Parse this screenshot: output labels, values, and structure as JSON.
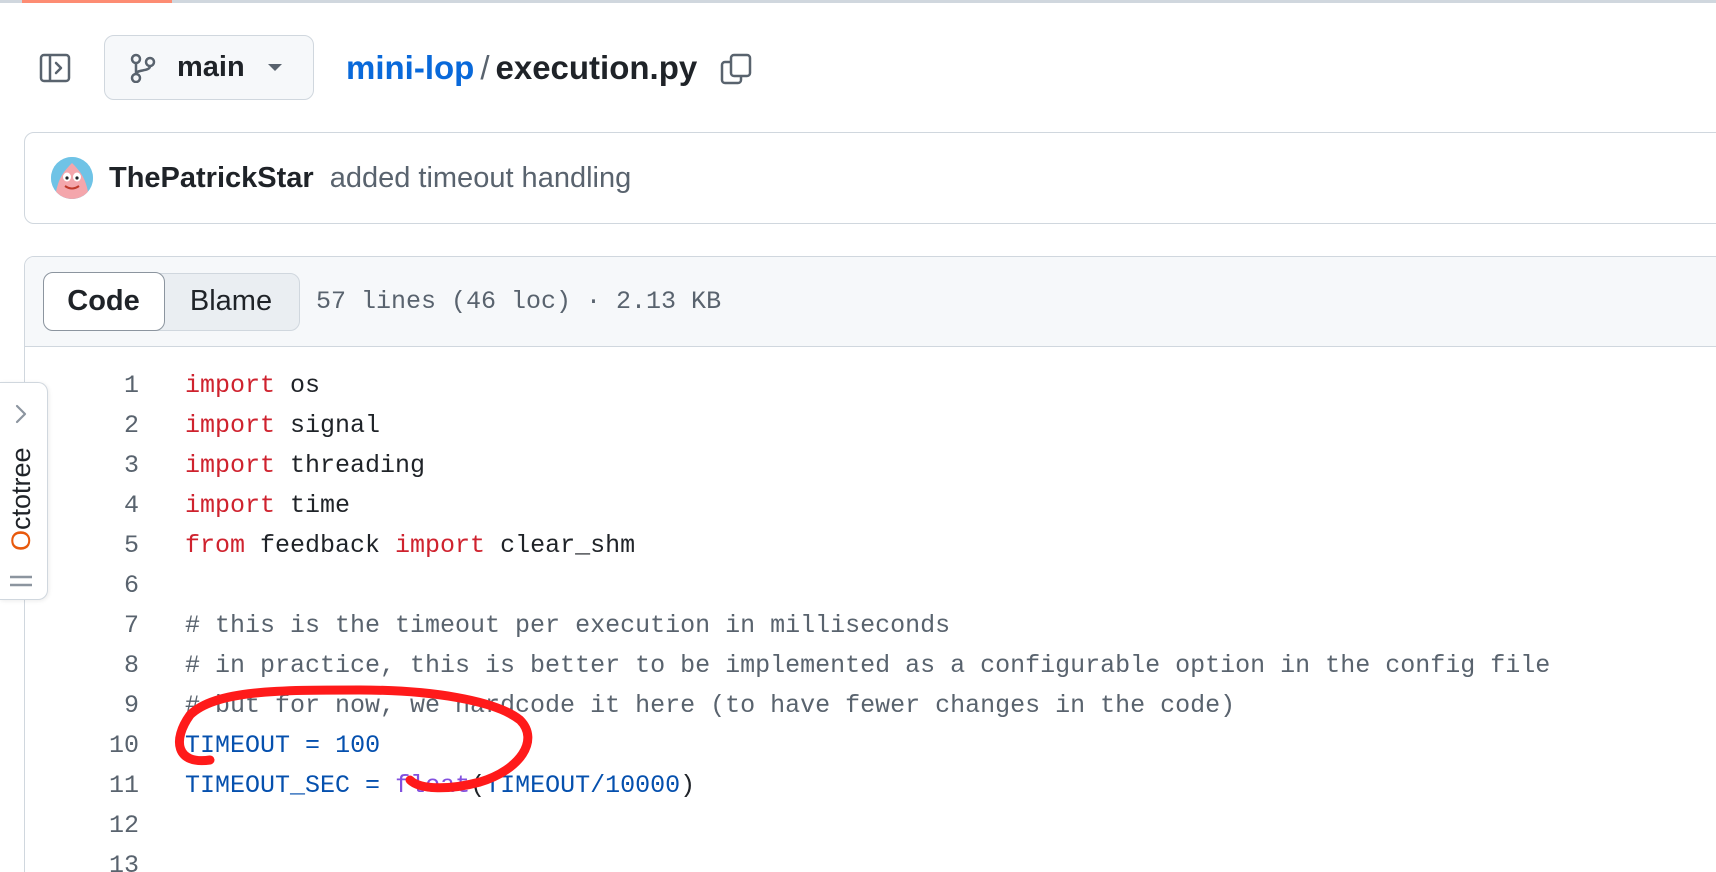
{
  "header": {
    "branch": "main",
    "repo": "mini-lop",
    "separator": "/",
    "file": "execution.py"
  },
  "commit": {
    "author": "ThePatrickStar",
    "message": "added timeout handling"
  },
  "file_header": {
    "code_tab": "Code",
    "blame_tab": "Blame",
    "meta": "57 lines (46 loc) · 2.13 KB"
  },
  "code_lines": [
    {
      "n": "1",
      "tokens": [
        [
          "kw",
          "import"
        ],
        [
          "",
          " os"
        ]
      ]
    },
    {
      "n": "2",
      "tokens": [
        [
          "kw",
          "import"
        ],
        [
          "",
          " signal"
        ]
      ]
    },
    {
      "n": "3",
      "tokens": [
        [
          "kw",
          "import"
        ],
        [
          "",
          " threading"
        ]
      ]
    },
    {
      "n": "4",
      "tokens": [
        [
          "kw",
          "import"
        ],
        [
          "",
          " time"
        ]
      ]
    },
    {
      "n": "5",
      "tokens": [
        [
          "kw",
          "from"
        ],
        [
          "",
          " feedback "
        ],
        [
          "kw",
          "import"
        ],
        [
          "",
          " clear_shm"
        ]
      ]
    },
    {
      "n": "6",
      "tokens": []
    },
    {
      "n": "7",
      "tokens": [
        [
          "cm",
          "# this is the timeout per execution in milliseconds"
        ]
      ]
    },
    {
      "n": "8",
      "tokens": [
        [
          "cm",
          "# in practice, this is better to be implemented as a configurable option in the config file"
        ]
      ]
    },
    {
      "n": "9",
      "tokens": [
        [
          "cm",
          "# but for now, we hardcode it here (to have fewer changes in the code)"
        ]
      ]
    },
    {
      "n": "10",
      "tokens": [
        [
          "const",
          "TIMEOUT"
        ],
        [
          "",
          " "
        ],
        [
          "const",
          "="
        ],
        [
          "",
          " "
        ],
        [
          "const",
          "100"
        ]
      ]
    },
    {
      "n": "11",
      "tokens": [
        [
          "const",
          "TIMEOUT_SEC"
        ],
        [
          "",
          " "
        ],
        [
          "const",
          "="
        ],
        [
          "",
          " "
        ],
        [
          "fn",
          "float"
        ],
        [
          "",
          "("
        ],
        [
          "const",
          "TIMEOUT/10000"
        ],
        [
          "",
          ")"
        ]
      ]
    },
    {
      "n": "12",
      "tokens": []
    },
    {
      "n": "13",
      "tokens": []
    }
  ],
  "octotree": {
    "first_letter": "O",
    "rest": "ctotree"
  },
  "colors": {
    "link": "#0969da",
    "keyword": "#cf222e",
    "constant": "#0550ae",
    "function": "#8250df",
    "comment": "#59636e",
    "annotation": "#ff1a1a"
  }
}
